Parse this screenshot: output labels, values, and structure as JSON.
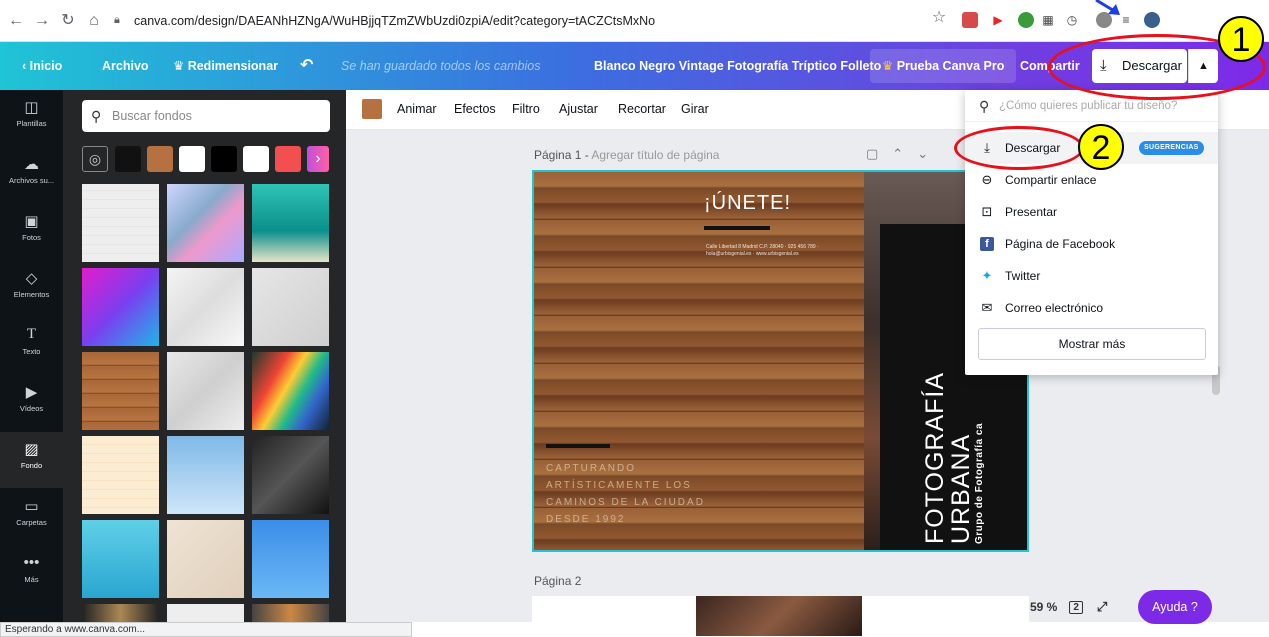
{
  "browser": {
    "url": "canva.com/design/DAEANhHZNgA/WuHBjjqTZmZWbUzdi0zpiA/edit?category=tACZCtsMxNo",
    "status": "Esperando a www.canva.com..."
  },
  "header": {
    "home": "Inicio",
    "file": "Archivo",
    "resize": "Redimensionar",
    "saved": "Se han guardado todos los cambios",
    "title": "Blanco Negro Vintage Fotografía Tríptico Folleto",
    "pro": "Prueba Canva Pro",
    "share": "Compartir",
    "download": "Descargar"
  },
  "rail": [
    {
      "label": "Plantillas",
      "icon": "templates-icon"
    },
    {
      "label": "Archivos su...",
      "icon": "upload-icon"
    },
    {
      "label": "Fotos",
      "icon": "photos-icon"
    },
    {
      "label": "Elementos",
      "icon": "elements-icon"
    },
    {
      "label": "Texto",
      "icon": "text-icon"
    },
    {
      "label": "Vídeos",
      "icon": "video-icon"
    },
    {
      "label": "Fondo",
      "icon": "background-icon"
    },
    {
      "label": "Carpetas",
      "icon": "folder-icon"
    },
    {
      "label": "Más",
      "icon": "more-icon"
    }
  ],
  "panel": {
    "search_placeholder": "Buscar fondos",
    "swatches": [
      "#111111",
      "#b5713f",
      "#ffffff",
      "#000000",
      "#ffffff",
      "#f25050"
    ]
  },
  "toolbar": {
    "items": [
      "Animar",
      "Efectos",
      "Filtro",
      "Ajustar",
      "Recortar",
      "Girar"
    ]
  },
  "canvas": {
    "page1_label": "Página 1 -",
    "page1_sub": "Agregar título de página",
    "page2_label": "Página 2",
    "design": {
      "heading": "¡ÚNETE!",
      "contact": "Calle Libertad 8 Madrid C.P. 28040 · 925 456 789 · hola@urbisgenial.es · www.urbisgenial.es",
      "tagline": "CAPTURANDO ARTÍSTICAMENTE LOS CAMINOS DE LA CIUDAD DESDE 1992",
      "vertical_1": "FOTOGRAFÍA",
      "vertical_2": "URBANA",
      "vertical_3": "Grupo de Fotografía ca"
    }
  },
  "zoom": {
    "level": "59 %",
    "pages": "2",
    "help": "Ayuda ?"
  },
  "dropdown": {
    "search_placeholder": "¿Cómo quieres publicar tu diseño?",
    "items": [
      {
        "label": "Descargar",
        "icon": "download-icon"
      },
      {
        "label": "Compartir enlace",
        "icon": "link-icon"
      },
      {
        "label": "Presentar",
        "icon": "present-icon"
      },
      {
        "label": "Página de Facebook",
        "icon": "facebook-icon"
      },
      {
        "label": "Twitter",
        "icon": "twitter-icon"
      },
      {
        "label": "Correo electrónico",
        "icon": "mail-icon"
      }
    ],
    "badge": "SUGERENCIAS",
    "more": "Mostrar más"
  },
  "annotations": {
    "one": "1",
    "two": "2"
  },
  "colors": {
    "accent": "#7d2ae8",
    "annotation": "#e8101a",
    "marker": "#ffff00"
  }
}
